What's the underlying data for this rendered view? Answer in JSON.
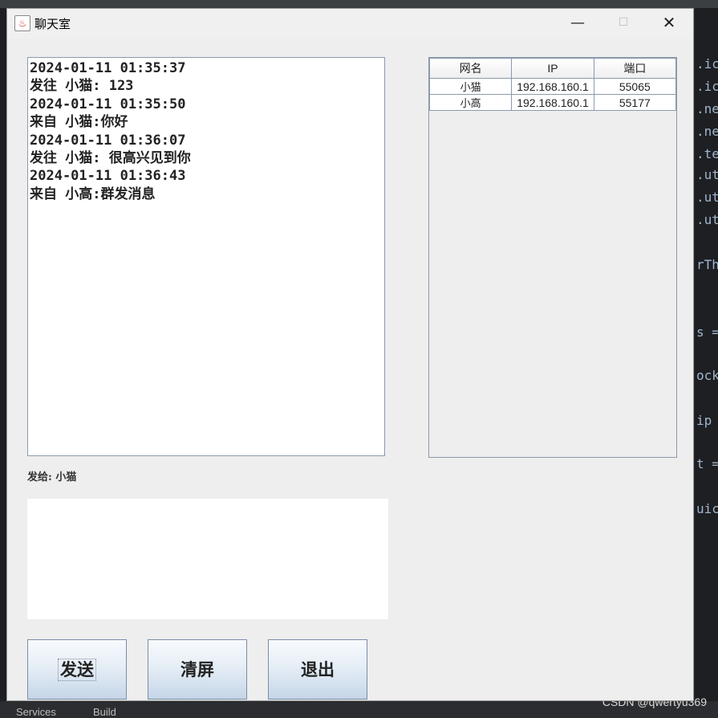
{
  "window": {
    "title": "聊天室",
    "min_icon": "—",
    "max_icon": "☐",
    "close_icon": "✕"
  },
  "chat": {
    "messages": [
      "2024-01-11 01:35:37",
      "发往 小猫: 123",
      "2024-01-11 01:35:50",
      "来自 小猫:你好",
      "2024-01-11 01:36:07",
      "发往 小猫: 很高兴见到你",
      "2024-01-11 01:36:43",
      "来自 小高:群发消息"
    ]
  },
  "send_to_label": "发给: 小猫",
  "input_value": "",
  "buttons": {
    "send": "发送",
    "clear": "清屏",
    "exit": "退出"
  },
  "users": {
    "columns": [
      "网名",
      "IP",
      "端口"
    ],
    "rows": [
      [
        "小猫",
        "192.168.160.1",
        "55065"
      ],
      [
        "小高",
        "192.168.160.1",
        "55177"
      ]
    ]
  },
  "background": {
    "status_services": "Services",
    "status_build": "Build",
    "watermark": "CSDN @qwertyu369"
  }
}
